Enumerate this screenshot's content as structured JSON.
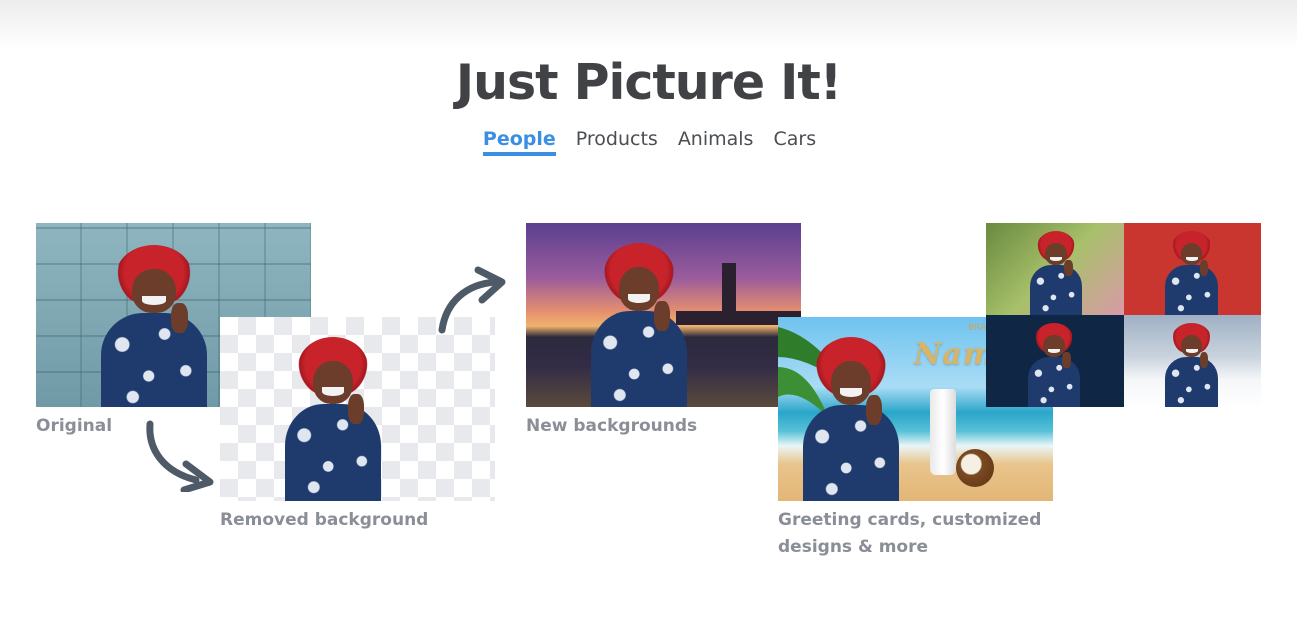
{
  "header": {
    "title": "Just Picture It!"
  },
  "tabs": [
    {
      "label": "People",
      "active": true
    },
    {
      "label": "Products",
      "active": false
    },
    {
      "label": "Animals",
      "active": false
    },
    {
      "label": "Cars",
      "active": false
    }
  ],
  "captions": {
    "original": "Original",
    "removed": "Removed background",
    "new_backgrounds": "New backgrounds",
    "greeting_line1": "Greeting cards, customized",
    "greeting_line2": "designs & more"
  },
  "card_text": {
    "brand": "BRAND",
    "name": "Name"
  },
  "colors": {
    "accent": "#3b8fe2",
    "title": "#404246",
    "caption": "#8a8e96",
    "arrow": "#4f5a68"
  },
  "icons": [
    "curved-arrow-down-right-icon",
    "curved-arrow-up-right-icon"
  ]
}
